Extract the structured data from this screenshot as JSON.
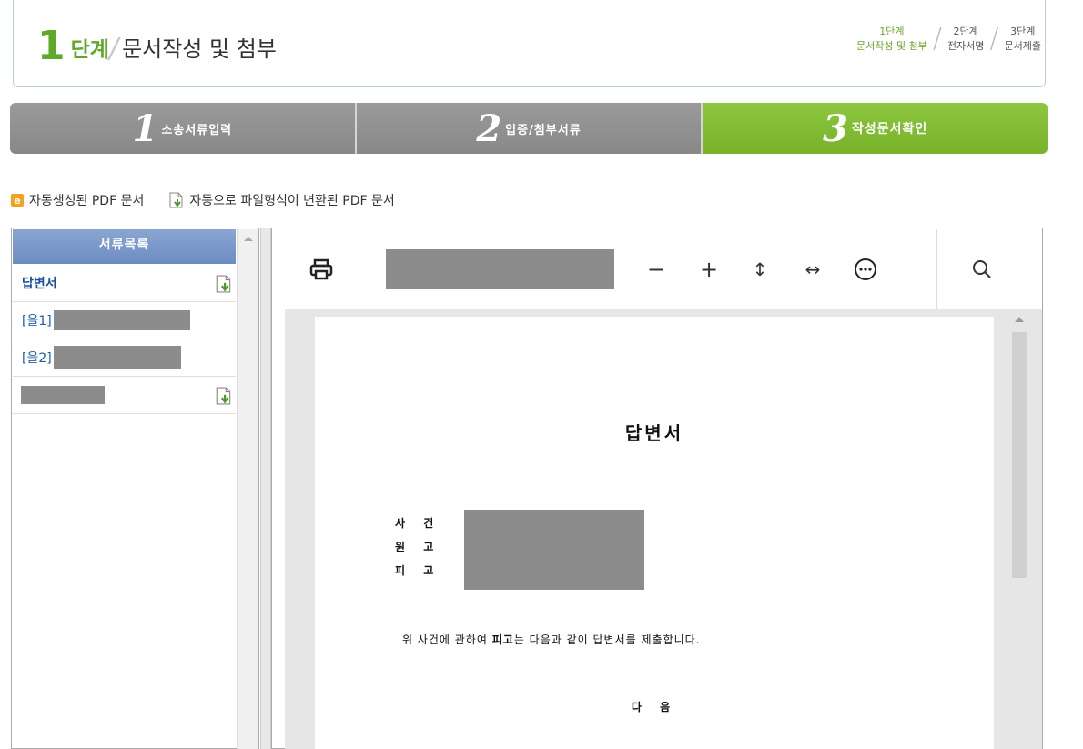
{
  "header": {
    "step_number": "1",
    "step_word": "단계",
    "step_name": "문서작성 및 첨부",
    "steps": [
      {
        "line1": "1단계",
        "line2": "문서작성 및 첨부"
      },
      {
        "line1": "2단계",
        "line2": "전자서명"
      },
      {
        "line1": "3단계",
        "line2": "문서제출"
      }
    ]
  },
  "tabs": [
    {
      "num": "1",
      "label": "소송서류입력"
    },
    {
      "num": "2",
      "label": "입증/첨부서류"
    },
    {
      "num": "3",
      "label": "작성문서확인"
    }
  ],
  "legend": {
    "auto_pdf": "자동생성된 PDF 문서",
    "converted_pdf": "자동으로 파일형식이 변환된 PDF 문서"
  },
  "doc_list": {
    "header": "서류목록",
    "items": [
      {
        "label": "답변서"
      },
      {
        "label": "[을1]"
      },
      {
        "label": "[을2]"
      },
      {
        "label": ""
      }
    ]
  },
  "document": {
    "title": "답변서",
    "fields": [
      "사 건",
      "원 고",
      "피 고"
    ],
    "line_pre": "위 사건에 관하여 ",
    "line_bold": "피고",
    "line_post": "는 다음과 같이 답변서를 제출합니다.",
    "next": "다 음"
  },
  "colors": {
    "accent_green": "#77b22a",
    "tab_gray": "#8f8f8f",
    "list_header": "#7495c8"
  }
}
